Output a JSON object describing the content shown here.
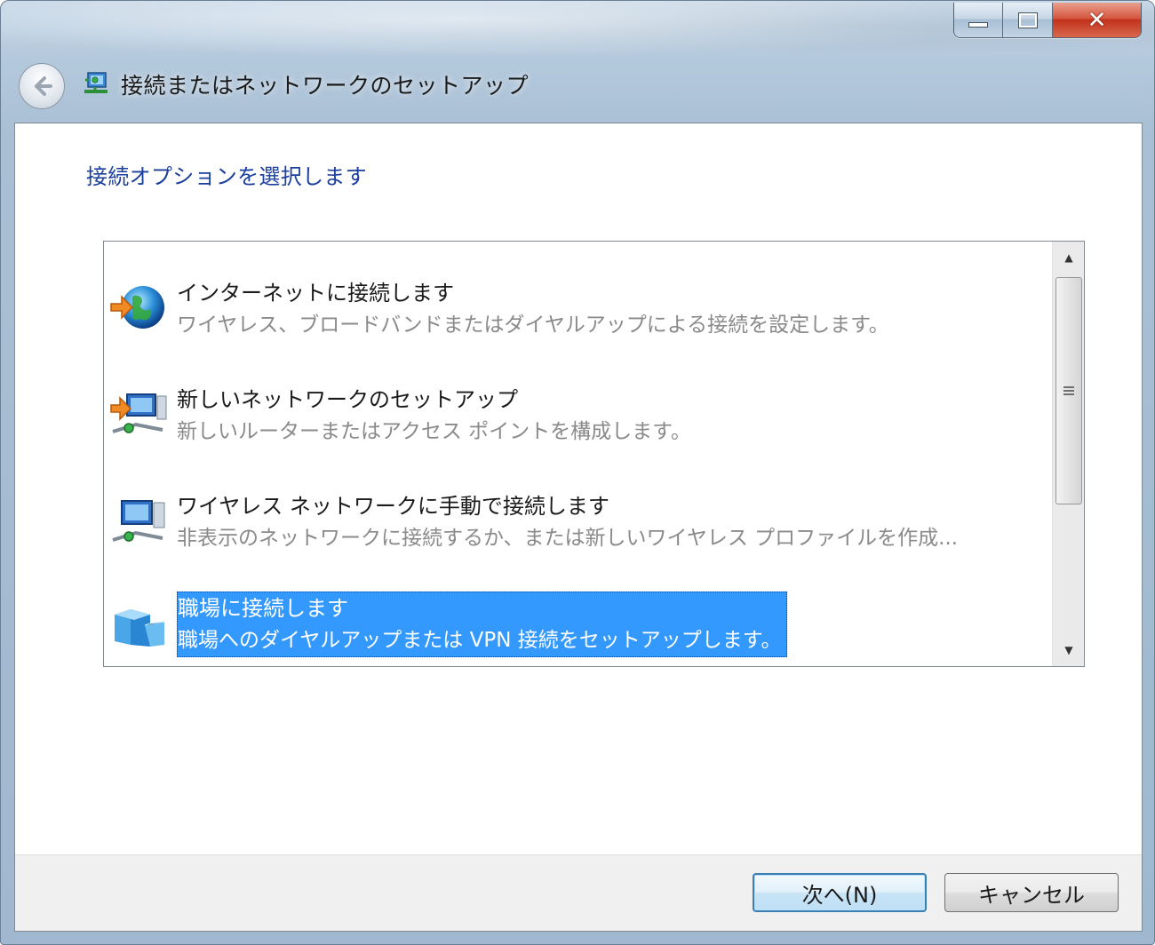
{
  "window": {
    "title": "接続またはネットワークのセットアップ",
    "caption_buttons": [
      "minimize-icon",
      "maximize-icon",
      "close-icon"
    ]
  },
  "main": {
    "instruction": "接続オプションを選択します",
    "options": [
      {
        "title": "インターネットに接続します",
        "desc": "ワイヤレス、ブロードバンドまたはダイヤルアップによる接続を設定します。",
        "icon": "globe-connect-icon",
        "selected": false
      },
      {
        "title": "新しいネットワークのセットアップ",
        "desc": "新しいルーターまたはアクセス ポイントを構成します。",
        "icon": "network-setup-icon",
        "selected": false
      },
      {
        "title": "ワイヤレス ネットワークに手動で接続します",
        "desc": "非表示のネットワークに接続するか、または新しいワイヤレス プロファイルを作成...",
        "icon": "wireless-network-icon",
        "selected": false
      },
      {
        "title": "職場に接続します",
        "desc": "職場へのダイヤルアップまたは VPN 接続をセットアップします。",
        "icon": "workplace-icon",
        "selected": true
      }
    ]
  },
  "footer": {
    "next_label": "次へ(N)",
    "cancel_label": "キャンセル"
  },
  "colors": {
    "instruction": "#1b3f9c",
    "selection": "#3399ff"
  }
}
